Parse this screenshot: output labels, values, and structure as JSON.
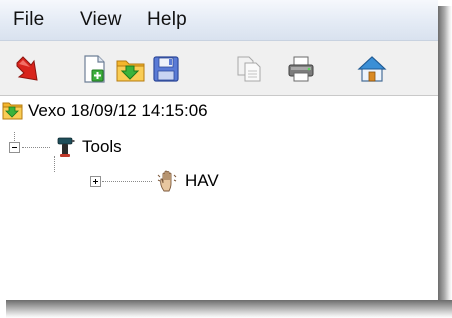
{
  "menu": {
    "items": [
      {
        "label": "File"
      },
      {
        "label": "View"
      },
      {
        "label": "Help"
      }
    ]
  },
  "toolbar": {
    "buttons": [
      {
        "icon": "red-down-arrow-icon"
      },
      {
        "icon": "new-document-icon"
      },
      {
        "icon": "import-folder-icon"
      },
      {
        "icon": "save-icon"
      },
      {
        "icon": "copy-icon"
      },
      {
        "icon": "print-icon"
      },
      {
        "icon": "home-icon"
      }
    ]
  },
  "tree": {
    "root": {
      "label": "Vexo 18/09/12 14:15:06",
      "icon": "folder-import-icon"
    },
    "tools": {
      "label": "Tools",
      "icon": "drill-icon",
      "expanded": true
    },
    "hav": {
      "label": "HAV",
      "icon": "vibrating-hand-icon",
      "expanded": false
    }
  }
}
